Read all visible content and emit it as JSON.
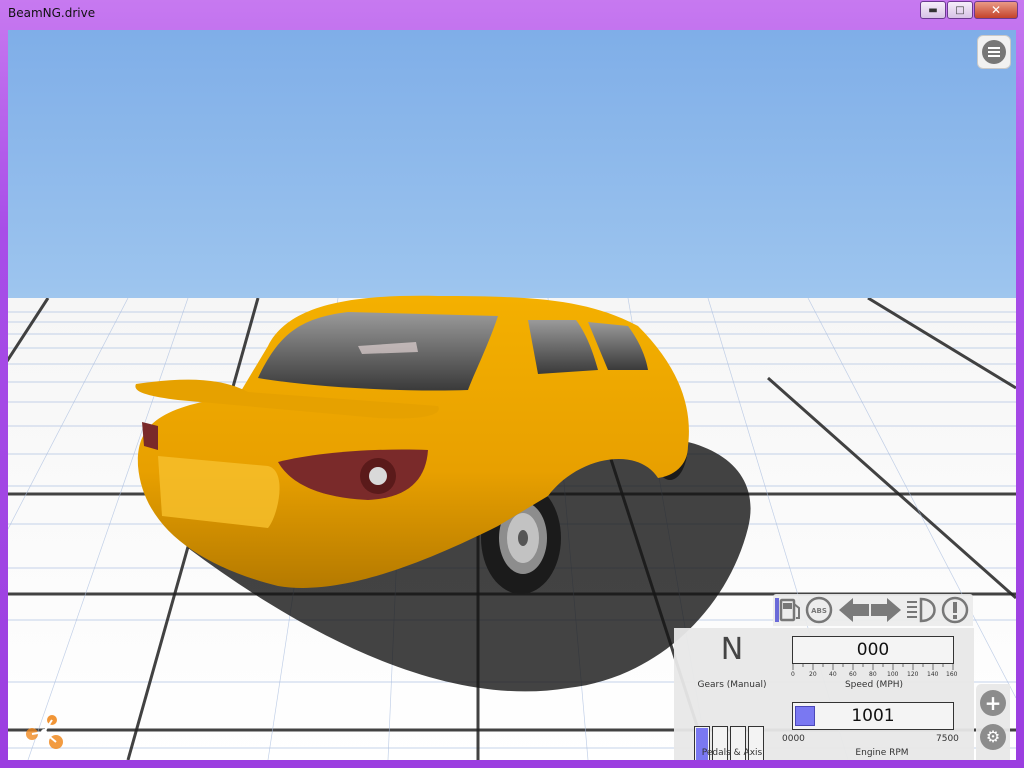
{
  "window": {
    "title": "BeamNG.drive",
    "minimize_icon": "minimize-icon",
    "maximize_icon": "maximize-icon",
    "close_icon": "close-icon"
  },
  "viewport": {
    "scene": "yellow sedan on grid ground, blue sky",
    "accent": "#7a78f2"
  },
  "menu": {
    "icon": "menu-icon"
  },
  "status_icons": [
    "fuel-icon",
    "abs-icon",
    "left-signal-icon",
    "right-signal-icon",
    "headlights-icon",
    "warning-icon"
  ],
  "gears": {
    "current": "N",
    "label": "Gears (Manual)"
  },
  "speed": {
    "value": "000",
    "label": "Speed (MPH)",
    "ticks": [
      "0",
      "20",
      "40",
      "60",
      "80",
      "100",
      "120",
      "140",
      "160"
    ]
  },
  "pedals": {
    "label": "Pedals & Axis",
    "values": [
      "100",
      "0",
      "0",
      "0"
    ],
    "levels": [
      1.0,
      0,
      0,
      0
    ]
  },
  "rpm": {
    "value": "1001",
    "label": "Engine RPM",
    "min": "0000",
    "max": "7500",
    "fraction": 0.13
  },
  "side_tools": [
    "add-icon",
    "settings-icon"
  ]
}
